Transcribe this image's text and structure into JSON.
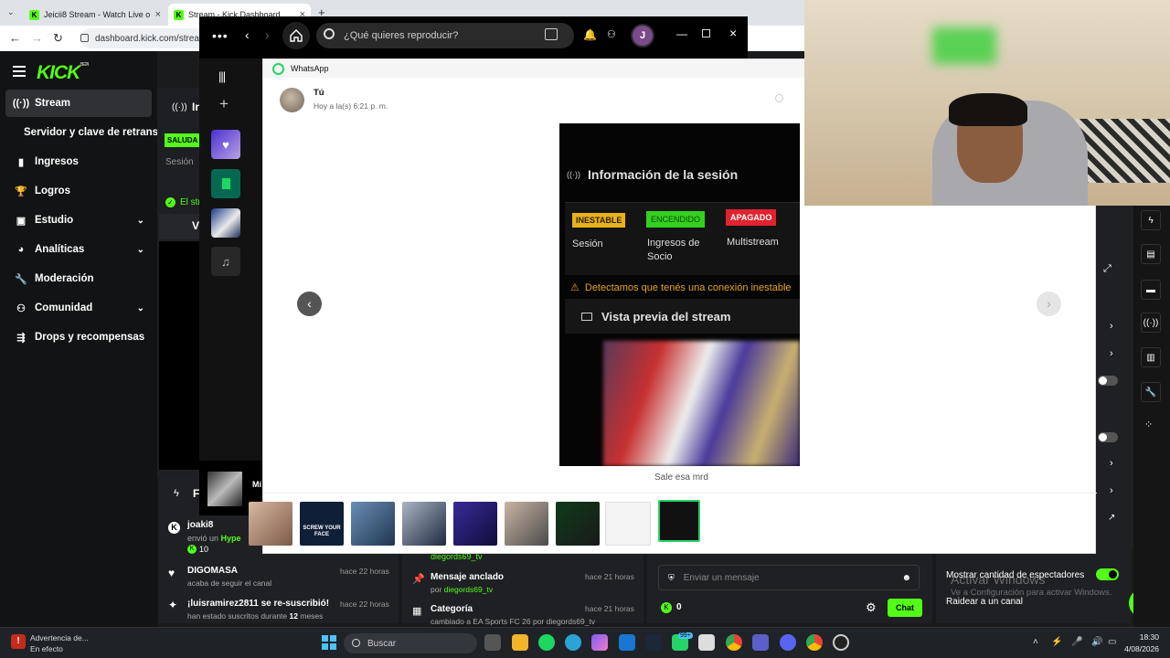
{
  "browser": {
    "tabs": [
      {
        "label": "Jeicii8 Stream - Watch Live on",
        "active": false
      },
      {
        "label": "Stream - Kick Dashboard",
        "active": true
      }
    ],
    "new_tab": "+",
    "url": "dashboard.kick.com/stream"
  },
  "kick": {
    "brand": "KICK",
    "beta": "BETA",
    "sidebar": [
      {
        "label": "Stream",
        "icon": "broadcast-icon",
        "selected": true
      },
      {
        "label": "Servidor y clave de retransn",
        "icon": "",
        "selected": false
      },
      {
        "label": "Ingresos",
        "icon": "bar-chart-icon",
        "selected": false
      },
      {
        "label": "Logros",
        "icon": "trophy-icon",
        "selected": false
      },
      {
        "label": "Estudio",
        "icon": "studio-icon",
        "selected": false
      },
      {
        "label": "Analíticas",
        "icon": "analytics-icon",
        "selected": false
      },
      {
        "label": "Moderación",
        "icon": "wrench-icon",
        "selected": false
      },
      {
        "label": "Comunidad",
        "icon": "community-icon",
        "selected": false
      },
      {
        "label": "Drops y recompensas",
        "icon": "drops-icon",
        "selected": false
      }
    ],
    "main": {
      "section_letter": "In",
      "badge": "SALUDA",
      "session": "Sesión",
      "status": "El str",
      "preview_letter": "V"
    },
    "activity": [
      {
        "user": "joaki8",
        "line": "envió un",
        "highlight": "Hype",
        "count": "10",
        "time": ""
      },
      {
        "user": "DIGOMASA",
        "line": "acaba de seguir el canal",
        "time": "hace 22 horas"
      },
      {
        "user": "¡luisramirez2811 se re-suscribió!",
        "line": "han estado suscritos durante",
        "months": "12",
        "months_suffix": "meses",
        "time": "hace 22 horas"
      }
    ],
    "feed_letter": "F",
    "mid": {
      "author_prefix": "por",
      "author": "diegords69_tv",
      "pinned": "Mensaje anclado",
      "pinned_time": "hace 21 horas",
      "category": "Categoría",
      "category_time": "hace 21 horas",
      "category_line": "cambiado a EA Sports FC 26 por diegords69_tv"
    },
    "chat": {
      "placeholder": "Enviar un mensaje",
      "count": "0",
      "button": "Chat"
    },
    "settings": {
      "viewers": "Mostrar cantidad de espectadores",
      "raid": "Raidear a un canal"
    },
    "windows_activation": {
      "title": "Activar Windows",
      "body": "Ve a Configuración para activar Windows."
    }
  },
  "spotify": {
    "search_placeholder": "¿Qué quieres reproducir?",
    "avatar": "J",
    "mini_title": "Mí"
  },
  "whatsapp": {
    "app": "WhatsApp",
    "sender": "Tú",
    "timestamp": "Hoy a la(s) 6:21 p. m.",
    "caption": "Sale esa mrd",
    "photo": {
      "heading": "Información de la sesión",
      "badges": [
        {
          "label": "INESTABLE",
          "caption": "Sesión",
          "color": "#e8b21a"
        },
        {
          "label": "ENCENDIDO",
          "caption": "Ingresos de Socio",
          "color": "#33d11f"
        },
        {
          "label": "APAGADO",
          "caption": "Multistream",
          "color": "#e0232e"
        }
      ],
      "warning": "Detectamos que tenés una conexión inestable",
      "preview": "Vista previa del stream"
    },
    "thumb_text": "SCREW YOUR FACE"
  },
  "taskbar": {
    "warning_title": "Advertencia de...",
    "warning_sub": "En efecto",
    "search": "Buscar",
    "badge": "99+",
    "time": "18:30",
    "date": "4/08/2026"
  },
  "colors": {
    "kick_green": "#53fc18",
    "kick_dark": "#121314",
    "wa_green": "#25d366"
  }
}
